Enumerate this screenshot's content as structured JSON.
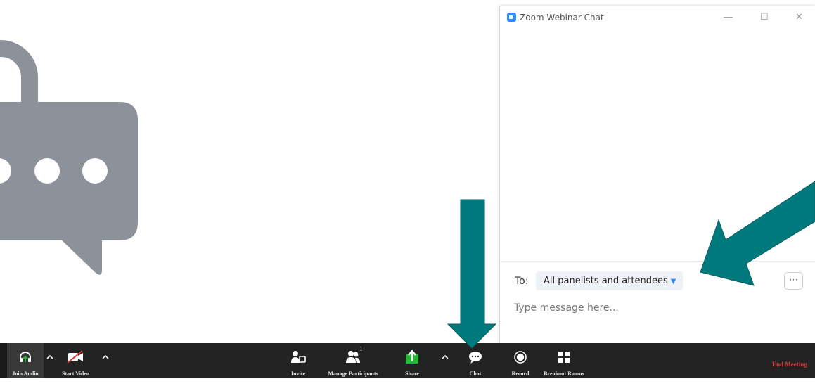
{
  "chat_window": {
    "title": "Zoom Webinar Chat",
    "window_controls": {
      "minimize": "—",
      "maximize": "☐",
      "close": "✕"
    },
    "to_label": "To:",
    "recipient": "All panelists and attendees",
    "more_label": "···",
    "message_placeholder": "Type message here..."
  },
  "toolbar": {
    "join_audio": "Join Audio",
    "start_video": "Start Video",
    "invite": "Invite",
    "manage_participants": "Manage Participants",
    "participant_count": "1",
    "share": "Share",
    "chat": "Chat",
    "record": "Record",
    "breakout_rooms": "Breakout Rooms",
    "end_meeting": "End Meeting"
  },
  "colors": {
    "toolbar_bg": "#232323",
    "arrow": "#007a7c",
    "illustration": "#8d929a",
    "share_green": "#27b534",
    "end_meeting_red": "#e03a3a",
    "zoom_blue": "#2d8cff"
  },
  "icons": {
    "illustration": "chat-bubble-with-dots",
    "join_audio": "headphones-icon",
    "start_video": "video-off-icon",
    "invite": "person-plus-icon",
    "manage_participants": "people-icon",
    "share": "share-up-arrow-icon",
    "chat": "chat-bubble-icon",
    "record": "record-circle-icon",
    "breakout_rooms": "grid-icon"
  }
}
